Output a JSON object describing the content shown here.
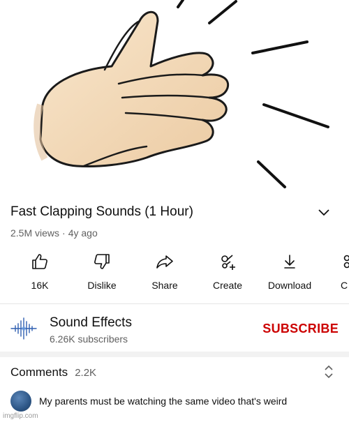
{
  "video": {
    "title": "Fast Clapping Sounds (1 Hour)",
    "views": "2.5M views",
    "separator": "·",
    "age": "4y ago"
  },
  "actions": [
    {
      "icon": "thumbs-up-icon",
      "label": "16K"
    },
    {
      "icon": "thumbs-down-icon",
      "label": "Dislike"
    },
    {
      "icon": "share-icon",
      "label": "Share"
    },
    {
      "icon": "create-icon",
      "label": "Create"
    },
    {
      "icon": "download-icon",
      "label": "Download"
    },
    {
      "icon": "clip-icon",
      "label": "C"
    }
  ],
  "channel": {
    "name": "Sound Effects",
    "subscribers": "6.26K subscribers",
    "subscribe_label": "SUBSCRIBE"
  },
  "comments": {
    "header": "Comments",
    "count": "2.2K",
    "top_comment": "My parents must be watching the same video that's weird"
  },
  "watermark": "imgflip.com",
  "colors": {
    "subscribe": "#cc0000",
    "secondary_text": "#606060",
    "primary_text": "#0f0f0f",
    "skin": "#f5dcbc",
    "skin_shadow": "#e8c49a"
  }
}
